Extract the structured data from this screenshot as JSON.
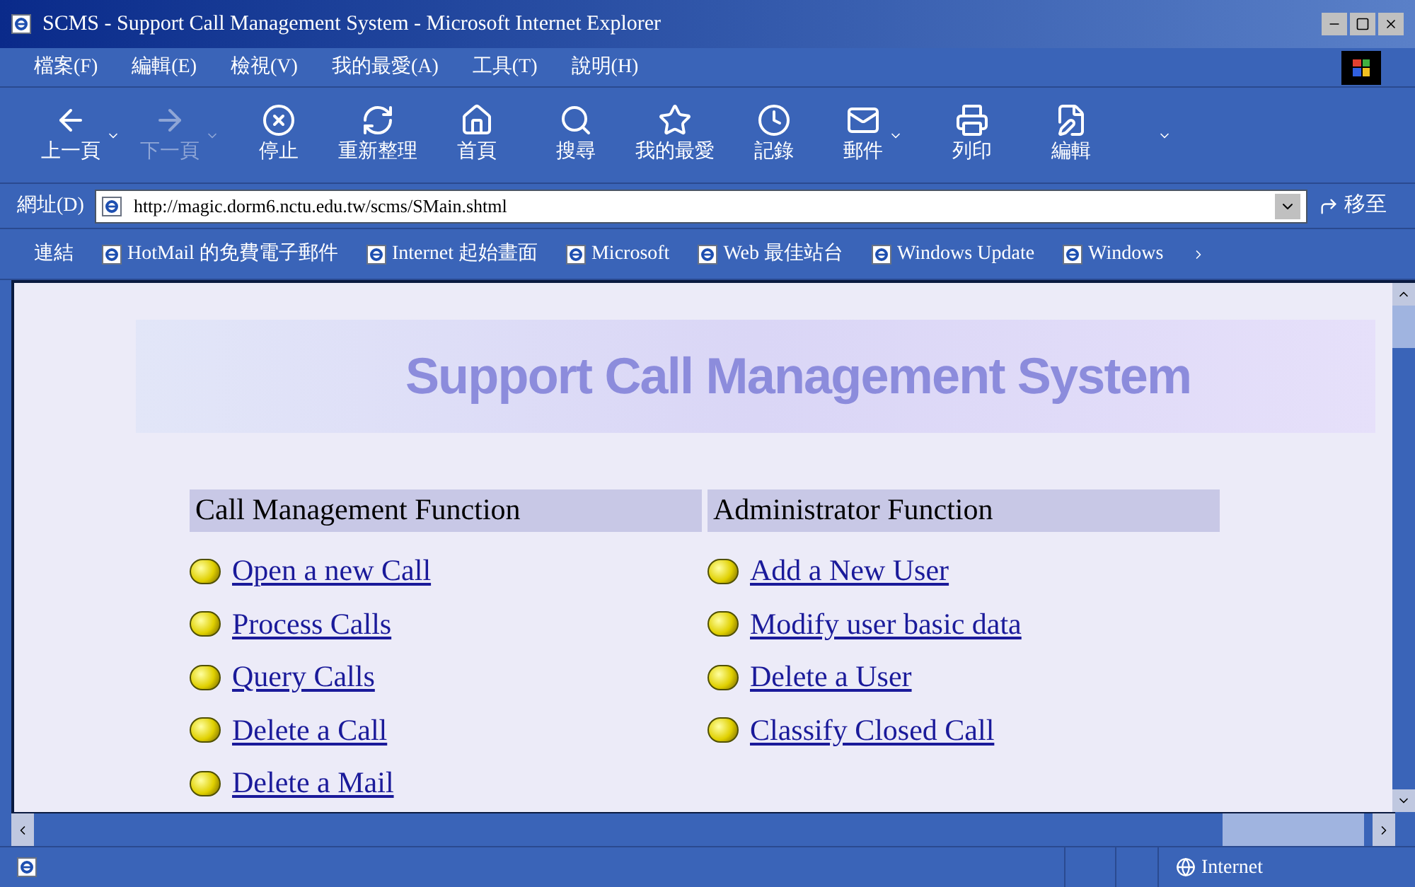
{
  "window": {
    "title": "SCMS - Support Call Management System - Microsoft Internet Explorer"
  },
  "menu": [
    "檔案(F)",
    "編輯(E)",
    "檢視(V)",
    "我的最愛(A)",
    "工具(T)",
    "說明(H)"
  ],
  "toolbar": [
    {
      "kind": "back",
      "label": "上一頁",
      "disabled": false,
      "dropdown": true
    },
    {
      "kind": "forward",
      "label": "下一頁",
      "disabled": true,
      "dropdown": true
    },
    {
      "kind": "stop",
      "label": "停止",
      "disabled": false,
      "dropdown": false
    },
    {
      "kind": "refresh",
      "label": "重新整理",
      "disabled": false,
      "dropdown": false
    },
    {
      "kind": "home",
      "label": "首頁",
      "disabled": false,
      "dropdown": false
    },
    {
      "kind": "search",
      "label": "搜尋",
      "disabled": false,
      "dropdown": false
    },
    {
      "kind": "favorites",
      "label": "我的最愛",
      "disabled": false,
      "dropdown": false
    },
    {
      "kind": "history",
      "label": "記錄",
      "disabled": false,
      "dropdown": false
    },
    {
      "kind": "mail",
      "label": "郵件",
      "disabled": false,
      "dropdown": true
    },
    {
      "kind": "print",
      "label": "列印",
      "disabled": false,
      "dropdown": false
    },
    {
      "kind": "edit",
      "label": "編輯",
      "disabled": false,
      "dropdown": false
    }
  ],
  "address": {
    "label": "網址(D)",
    "value": "http://magic.dorm6.nctu.edu.tw/scms/SMain.shtml",
    "go": "移至"
  },
  "links": {
    "label": "連結",
    "items": [
      "HotMail 的免費電子郵件",
      "Internet 起始畫面",
      "Microsoft",
      "Web 最佳站台",
      "Windows Update",
      "Windows"
    ]
  },
  "page": {
    "banner": "Support Call Management System",
    "sections": [
      {
        "title": "Call Management Function",
        "links": [
          "Open a new Call",
          "Process Calls",
          "Query Calls",
          "Delete a Call",
          "Delete a Mail"
        ]
      },
      {
        "title": "Administrator Function",
        "links": [
          "Add a New User",
          "Modify user basic data",
          "Delete a User",
          "Classify Closed Call"
        ]
      }
    ]
  },
  "status_bar": {
    "zone": "Internet"
  }
}
